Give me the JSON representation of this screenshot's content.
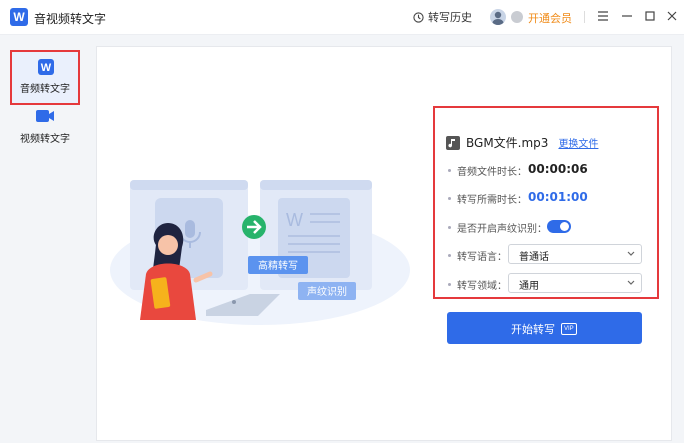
{
  "app": {
    "title": "音视频转文字",
    "logo_letter": "W"
  },
  "header": {
    "history_label": "转写历史",
    "vip_label": "开通会员"
  },
  "sidebar": {
    "items": [
      {
        "label": "音频转文字",
        "active": true
      },
      {
        "label": "视频转文字",
        "active": false
      }
    ]
  },
  "illustration": {
    "bubble_1": "高精转写",
    "bubble_2": "声纹识别"
  },
  "file": {
    "name": "BGM文件.mp3",
    "change_label": "更换文件"
  },
  "settings": {
    "duration_label": "音频文件时长：",
    "duration_value": "00:00:06",
    "need_label": "转写所需时长：",
    "need_value": "00:01:00",
    "voiceprint_label": "是否开启声纹识别：",
    "voiceprint_on": true,
    "language_label": "转写语言：",
    "language_value": "普通话",
    "domain_label": "转写领域：",
    "domain_value": "通用"
  },
  "start": {
    "label": "开始转写",
    "vip_tag": "VIP"
  },
  "colors": {
    "accent": "#2f6be8",
    "highlight": "#e5393c",
    "vip": "#f08c1a"
  }
}
